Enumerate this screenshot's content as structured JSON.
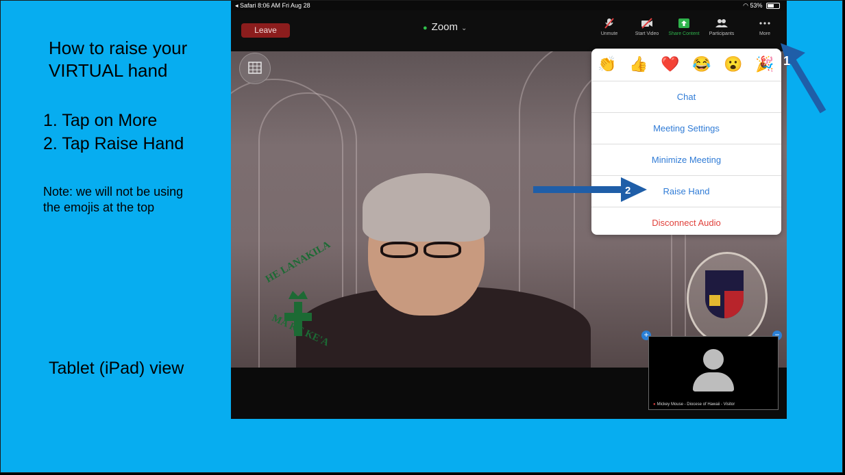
{
  "slide": {
    "title": "How to raise your\nVIRTUAL hand",
    "steps": "1. Tap on More\n2. Tap Raise Hand",
    "note": "Note: we will not be using\nthe emojis at the top",
    "caption": "Tablet (iPad) view",
    "background_color": "#07adf0"
  },
  "status_bar": {
    "left": "◂ Safari  8:06 AM  Fri Aug 28",
    "battery": "53%"
  },
  "zoom_bar": {
    "leave_label": "Leave",
    "meeting_title": "Zoom",
    "tools": [
      {
        "label": "Unmute",
        "icon": "mic-muted-icon"
      },
      {
        "label": "Start Video",
        "icon": "video-off-icon"
      },
      {
        "label": "Share Content",
        "icon": "share-screen-icon"
      },
      {
        "label": "Participants",
        "icon": "participants-icon"
      },
      {
        "label": "More",
        "icon": "more-icon"
      }
    ]
  },
  "video": {
    "emblem_top": "HE LANAKILA",
    "emblem_bottom": "MA KE KE'A"
  },
  "thumbnail": {
    "name": "Mickey Mouse - Diocese of Hawaii - Visitor"
  },
  "menu": {
    "emojis": [
      "👏",
      "👍",
      "❤️",
      "😂",
      "😮",
      "🎉"
    ],
    "items": [
      "Chat",
      "Meeting Settings",
      "Minimize Meeting",
      "Raise Hand",
      "Disconnect Audio"
    ]
  },
  "callouts": {
    "arrow1": "1",
    "arrow2": "2",
    "arrow_color": "#1f5ea8"
  }
}
